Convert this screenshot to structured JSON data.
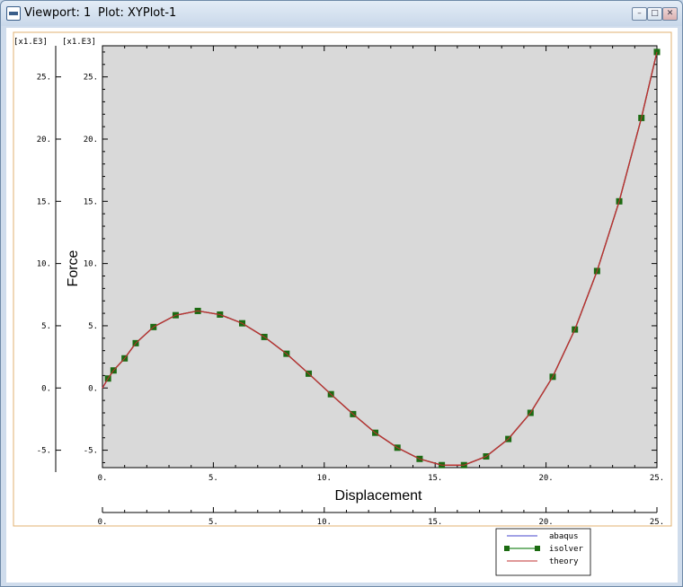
{
  "window": {
    "viewport_label": "Viewport: 1",
    "plot_label": "Plot: XYPlot-1",
    "buttons": {
      "minimize": "–",
      "maximize": "□",
      "close": "✕"
    }
  },
  "chart_data": {
    "type": "line",
    "xlabel": "Displacement",
    "ylabel": "Force",
    "x_scale_label": "[x1.E3]",
    "y_scale_label": "[x1.E3]",
    "xlim": [
      0,
      25
    ],
    "ylim": [
      -6.4,
      27.5
    ],
    "x_ticks": [
      0,
      5,
      10,
      15,
      20,
      25
    ],
    "x_tick_labels": [
      "0.",
      "5.",
      "10.",
      "15.",
      "20.",
      "25."
    ],
    "y_ticks": [
      -5,
      0,
      5,
      10,
      15,
      20,
      25
    ],
    "y_tick_labels": [
      "-5.",
      "0.",
      "5.",
      "10.",
      "15.",
      "20.",
      "25."
    ],
    "background": "#d9d9d9",
    "legend_position": "bottom-right",
    "series": [
      {
        "name": "abaqus",
        "color": "#4444cc",
        "style": "line",
        "x": [
          0,
          0.25,
          0.5,
          1,
          1.5,
          2.3,
          3.3,
          4.3,
          5.3,
          6.3,
          7.3,
          8.3,
          9.3,
          10.3,
          11.3,
          12.3,
          13.3,
          14.3,
          15.3,
          16.3,
          17.3,
          18.3,
          19.3,
          20.3,
          21.3,
          22.3,
          23.3,
          24.3,
          25
        ],
        "y": [
          0,
          0.76,
          1.41,
          2.38,
          3.6,
          4.9,
          5.85,
          6.19,
          5.9,
          5.2,
          4.1,
          2.75,
          1.15,
          -0.5,
          -2.1,
          -3.6,
          -4.8,
          -5.7,
          -6.2,
          -6.2,
          -5.5,
          -4.1,
          -2.0,
          0.9,
          4.7,
          9.4,
          15.0,
          21.7,
          27.0
        ]
      },
      {
        "name": "isolver",
        "color": "#2a8a2a",
        "marker_color": "#1c6b12",
        "style": "line+square",
        "x": [
          0.25,
          0.5,
          1,
          1.5,
          2.3,
          3.3,
          4.3,
          5.3,
          6.3,
          7.3,
          8.3,
          9.3,
          10.3,
          11.3,
          12.3,
          13.3,
          14.3,
          15.3,
          16.3,
          17.3,
          18.3,
          19.3,
          20.3,
          21.3,
          22.3,
          23.3,
          24.3,
          25
        ],
        "y": [
          0.76,
          1.41,
          2.38,
          3.6,
          4.9,
          5.85,
          6.19,
          5.9,
          5.2,
          4.1,
          2.75,
          1.15,
          -0.5,
          -2.1,
          -3.6,
          -4.8,
          -5.7,
          -6.2,
          -6.2,
          -5.5,
          -4.1,
          -2.0,
          0.9,
          4.7,
          9.4,
          15.0,
          21.7,
          27.0
        ]
      },
      {
        "name": "theory",
        "color": "#c03030",
        "style": "line",
        "x": [
          0,
          0.25,
          0.5,
          1,
          1.5,
          2.3,
          3.3,
          4.3,
          5.3,
          6.3,
          7.3,
          8.3,
          9.3,
          10.3,
          11.3,
          12.3,
          13.3,
          14.3,
          15.3,
          16.3,
          17.3,
          18.3,
          19.3,
          20.3,
          21.3,
          22.3,
          23.3,
          24.3,
          25
        ],
        "y": [
          0,
          0.76,
          1.41,
          2.38,
          3.6,
          4.9,
          5.85,
          6.19,
          5.9,
          5.2,
          4.1,
          2.75,
          1.15,
          -0.5,
          -2.1,
          -3.6,
          -4.8,
          -5.7,
          -6.2,
          -6.2,
          -5.5,
          -4.1,
          -2.0,
          0.9,
          4.7,
          9.4,
          15.0,
          21.7,
          27.0
        ]
      }
    ]
  }
}
